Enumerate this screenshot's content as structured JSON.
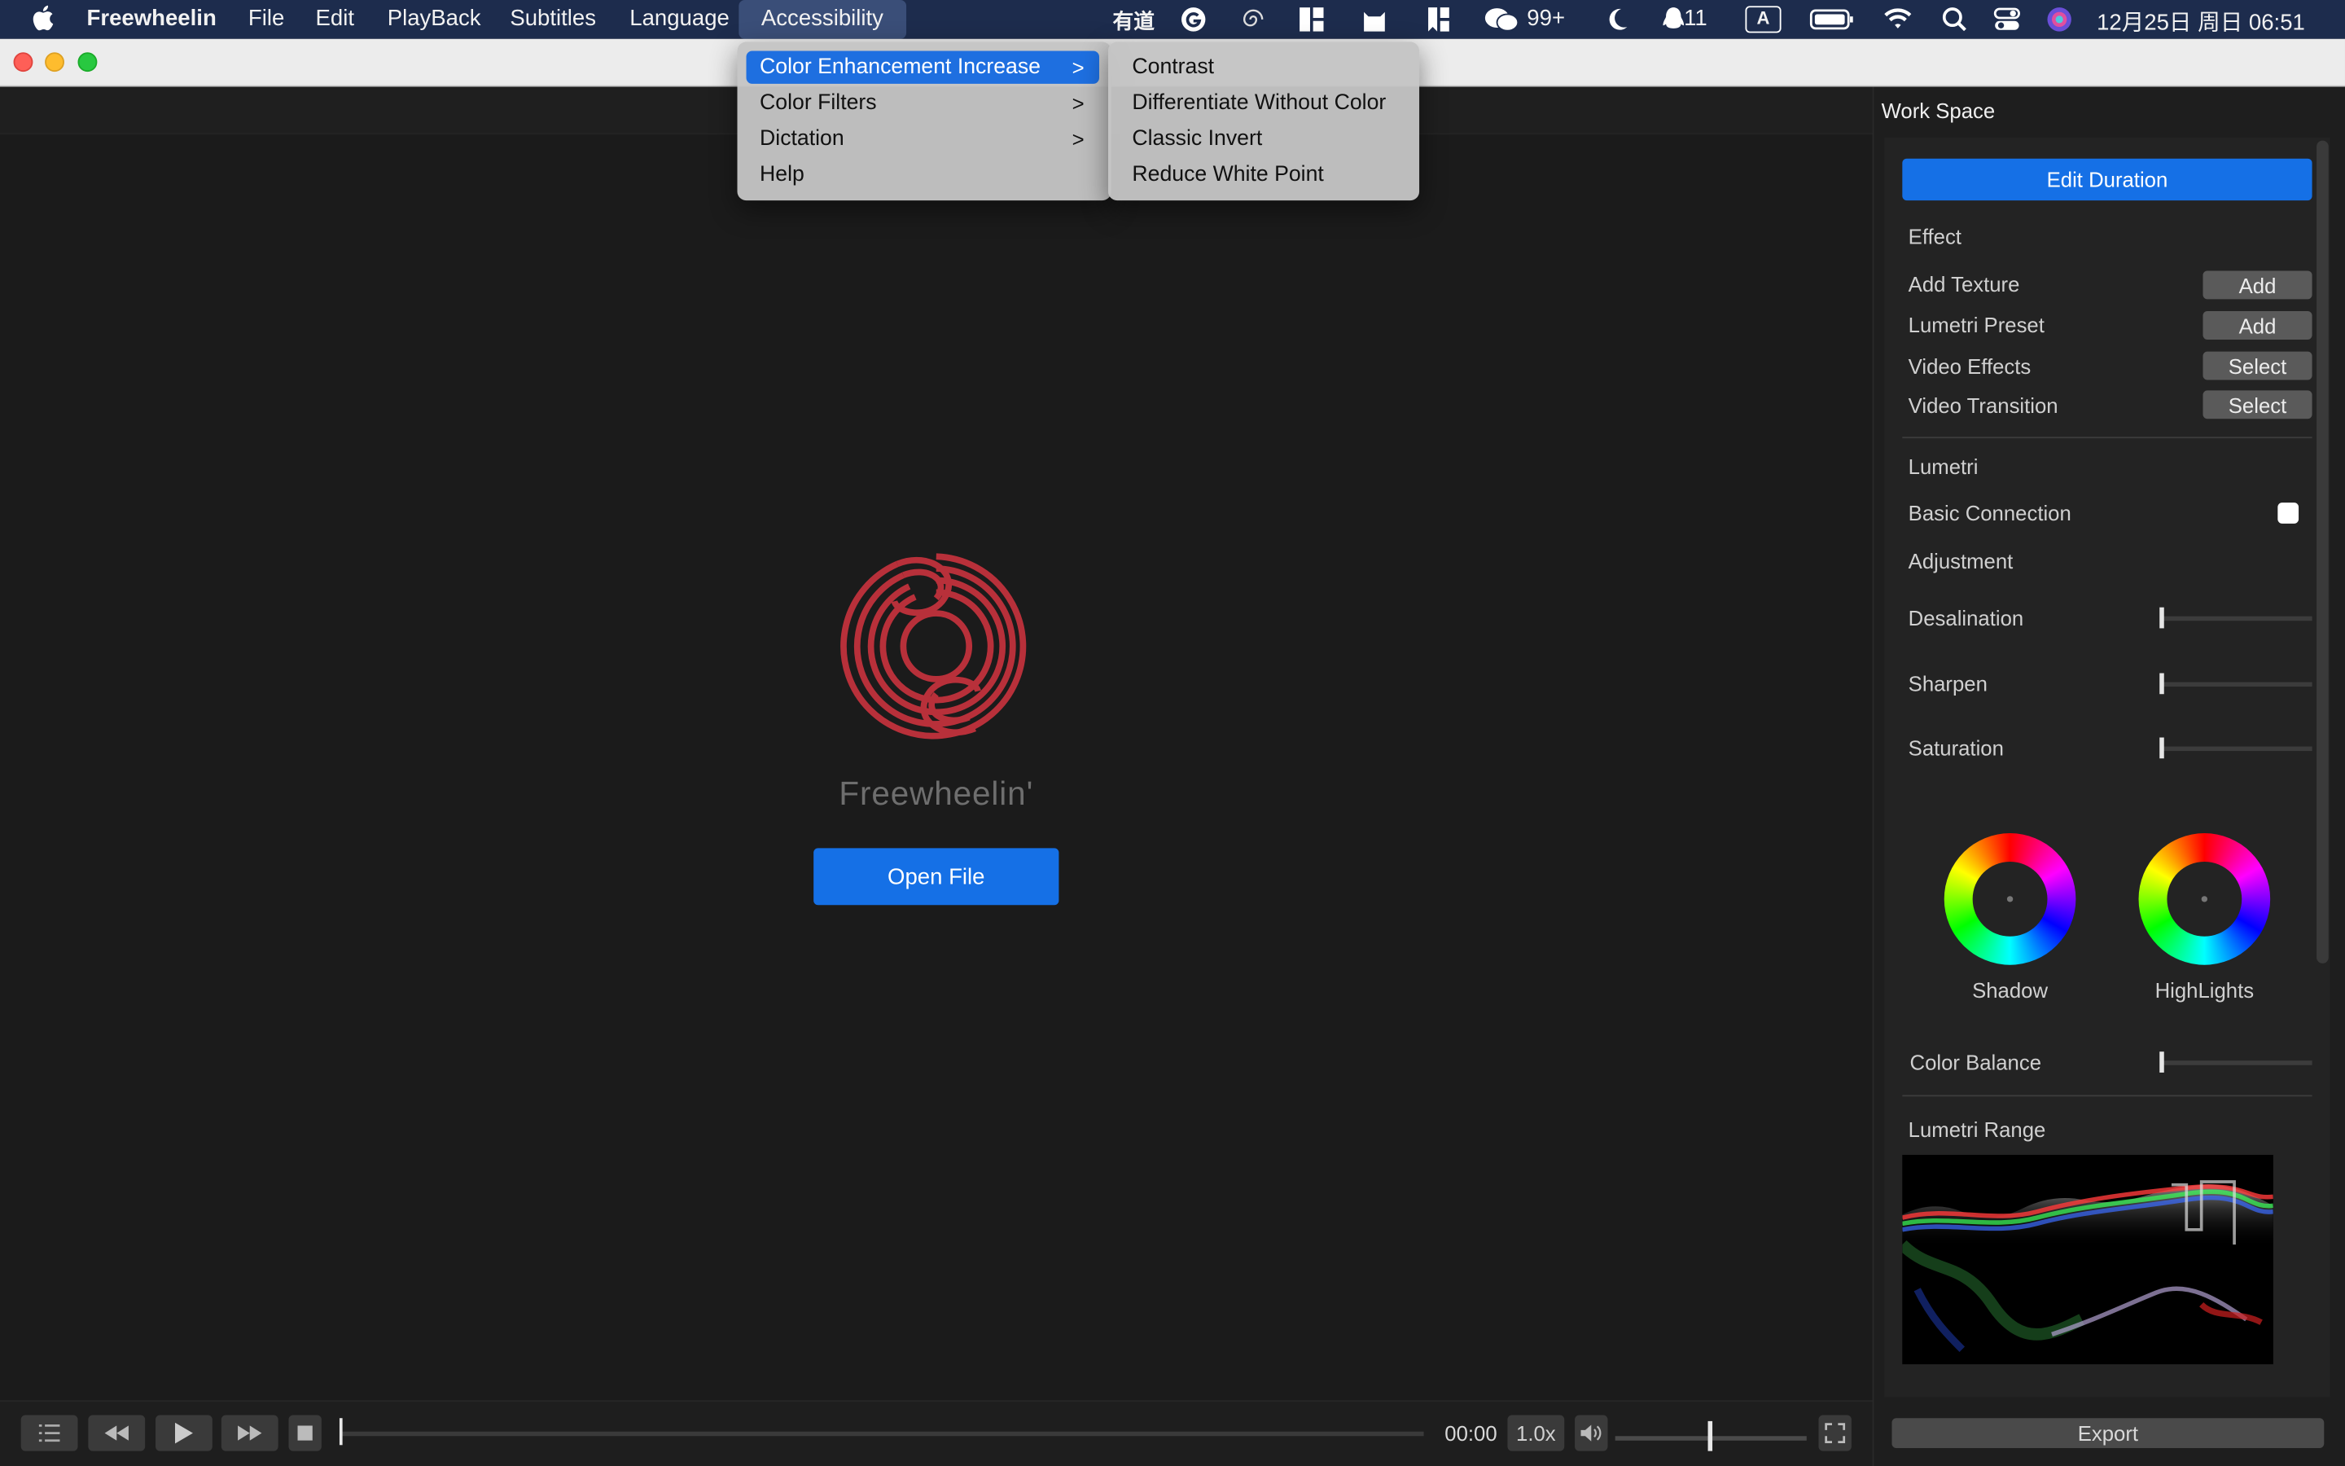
{
  "menubar": {
    "app_name": "Freewheelin",
    "menus": [
      "File",
      "Edit",
      "PlayBack",
      "Subtitles",
      "Language",
      "Accessibility"
    ],
    "status": {
      "youdao": "有道",
      "wechat_count": "99+",
      "qq_count": "11",
      "input_method": "A",
      "datetime": "12月25日 周日  06:51"
    }
  },
  "accessibility_menu": {
    "items": [
      {
        "label": "Color Enhancement Increase",
        "has_submenu": true,
        "highlighted": true
      },
      {
        "label": "Color Filters",
        "has_submenu": true
      },
      {
        "label": "Dictation",
        "has_submenu": true
      },
      {
        "label": "Help",
        "has_submenu": false
      }
    ],
    "submenu": [
      "Contrast",
      "Differentiate Without Color",
      "Classic Invert",
      "Reduce White Point"
    ]
  },
  "main": {
    "app_title": "Freewheelin'",
    "open_file_label": "Open File"
  },
  "controls": {
    "time": "00:00",
    "speed": "1.0x",
    "progress": 0,
    "volume": 0.5
  },
  "panel": {
    "title": "Work Space",
    "edit_duration_label": "Edit Duration",
    "effect_heading": "Effect",
    "effects": [
      {
        "label": "Add Texture",
        "button": "Add"
      },
      {
        "label": "Lumetri Preset",
        "button": "Add"
      },
      {
        "label": "Video Effects",
        "button": "Select"
      },
      {
        "label": "Video Transition",
        "button": "Select"
      }
    ],
    "lumetri_heading": "Lumetri",
    "basic_connection_label": "Basic Connection",
    "basic_connection_checked": false,
    "adjustment_heading": "Adjustment",
    "sliders": [
      {
        "label": "Desalination",
        "value": 0
      },
      {
        "label": "Sharpen",
        "value": 0
      },
      {
        "label": "Saturation",
        "value": 0
      }
    ],
    "wheels": [
      {
        "label": "Shadow"
      },
      {
        "label": "HighLights"
      }
    ],
    "color_balance_label": "Color Balance",
    "color_balance_value": 0,
    "lumetri_range_label": "Lumetri Range",
    "export_label": "Export"
  },
  "colors": {
    "accent": "#1570e6",
    "menubar_bg": "#1d2c4d",
    "logo_red": "#b8303a",
    "menu_highlight": "#1e6fe0"
  }
}
